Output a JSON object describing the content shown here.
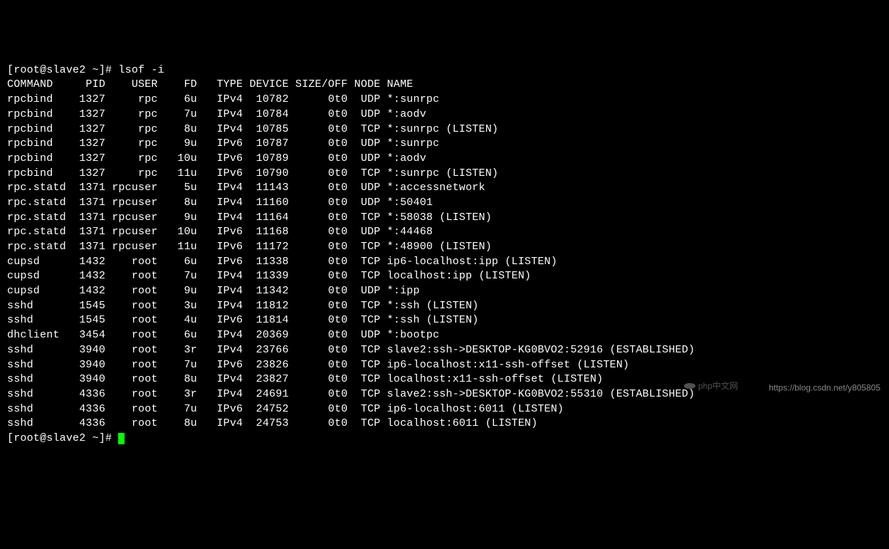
{
  "prompt": "[root@slave2 ~]# lsof -i",
  "prompt2": "[root@slave2 ~]# ",
  "headers": {
    "command": "COMMAND",
    "pid": "PID",
    "user": "USER",
    "fd": "FD",
    "type": "TYPE",
    "device": "DEVICE",
    "sizeoff": "SIZE/OFF",
    "node": "NODE",
    "name": "NAME"
  },
  "rows": [
    {
      "command": "rpcbind",
      "pid": "1327",
      "user": "rpc",
      "fd": "6u",
      "type": "IPv4",
      "device": "10782",
      "sizeoff": "0t0",
      "node": "UDP",
      "name": "*:sunrpc"
    },
    {
      "command": "rpcbind",
      "pid": "1327",
      "user": "rpc",
      "fd": "7u",
      "type": "IPv4",
      "device": "10784",
      "sizeoff": "0t0",
      "node": "UDP",
      "name": "*:aodv"
    },
    {
      "command": "rpcbind",
      "pid": "1327",
      "user": "rpc",
      "fd": "8u",
      "type": "IPv4",
      "device": "10785",
      "sizeoff": "0t0",
      "node": "TCP",
      "name": "*:sunrpc (LISTEN)"
    },
    {
      "command": "rpcbind",
      "pid": "1327",
      "user": "rpc",
      "fd": "9u",
      "type": "IPv6",
      "device": "10787",
      "sizeoff": "0t0",
      "node": "UDP",
      "name": "*:sunrpc"
    },
    {
      "command": "rpcbind",
      "pid": "1327",
      "user": "rpc",
      "fd": "10u",
      "type": "IPv6",
      "device": "10789",
      "sizeoff": "0t0",
      "node": "UDP",
      "name": "*:aodv"
    },
    {
      "command": "rpcbind",
      "pid": "1327",
      "user": "rpc",
      "fd": "11u",
      "type": "IPv6",
      "device": "10790",
      "sizeoff": "0t0",
      "node": "TCP",
      "name": "*:sunrpc (LISTEN)"
    },
    {
      "command": "rpc.statd",
      "pid": "1371",
      "user": "rpcuser",
      "fd": "5u",
      "type": "IPv4",
      "device": "11143",
      "sizeoff": "0t0",
      "node": "UDP",
      "name": "*:accessnetwork"
    },
    {
      "command": "rpc.statd",
      "pid": "1371",
      "user": "rpcuser",
      "fd": "8u",
      "type": "IPv4",
      "device": "11160",
      "sizeoff": "0t0",
      "node": "UDP",
      "name": "*:50401"
    },
    {
      "command": "rpc.statd",
      "pid": "1371",
      "user": "rpcuser",
      "fd": "9u",
      "type": "IPv4",
      "device": "11164",
      "sizeoff": "0t0",
      "node": "TCP",
      "name": "*:58038 (LISTEN)"
    },
    {
      "command": "rpc.statd",
      "pid": "1371",
      "user": "rpcuser",
      "fd": "10u",
      "type": "IPv6",
      "device": "11168",
      "sizeoff": "0t0",
      "node": "UDP",
      "name": "*:44468"
    },
    {
      "command": "rpc.statd",
      "pid": "1371",
      "user": "rpcuser",
      "fd": "11u",
      "type": "IPv6",
      "device": "11172",
      "sizeoff": "0t0",
      "node": "TCP",
      "name": "*:48900 (LISTEN)"
    },
    {
      "command": "cupsd",
      "pid": "1432",
      "user": "root",
      "fd": "6u",
      "type": "IPv6",
      "device": "11338",
      "sizeoff": "0t0",
      "node": "TCP",
      "name": "ip6-localhost:ipp (LISTEN)"
    },
    {
      "command": "cupsd",
      "pid": "1432",
      "user": "root",
      "fd": "7u",
      "type": "IPv4",
      "device": "11339",
      "sizeoff": "0t0",
      "node": "TCP",
      "name": "localhost:ipp (LISTEN)"
    },
    {
      "command": "cupsd",
      "pid": "1432",
      "user": "root",
      "fd": "9u",
      "type": "IPv4",
      "device": "11342",
      "sizeoff": "0t0",
      "node": "UDP",
      "name": "*:ipp"
    },
    {
      "command": "sshd",
      "pid": "1545",
      "user": "root",
      "fd": "3u",
      "type": "IPv4",
      "device": "11812",
      "sizeoff": "0t0",
      "node": "TCP",
      "name": "*:ssh (LISTEN)"
    },
    {
      "command": "sshd",
      "pid": "1545",
      "user": "root",
      "fd": "4u",
      "type": "IPv6",
      "device": "11814",
      "sizeoff": "0t0",
      "node": "TCP",
      "name": "*:ssh (LISTEN)"
    },
    {
      "command": "dhclient",
      "pid": "3454",
      "user": "root",
      "fd": "6u",
      "type": "IPv4",
      "device": "20369",
      "sizeoff": "0t0",
      "node": "UDP",
      "name": "*:bootpc"
    },
    {
      "command": "sshd",
      "pid": "3940",
      "user": "root",
      "fd": "3r",
      "type": "IPv4",
      "device": "23766",
      "sizeoff": "0t0",
      "node": "TCP",
      "name": "slave2:ssh->DESKTOP-KG0BVO2:52916 (ESTABLISHED)"
    },
    {
      "command": "sshd",
      "pid": "3940",
      "user": "root",
      "fd": "7u",
      "type": "IPv6",
      "device": "23826",
      "sizeoff": "0t0",
      "node": "TCP",
      "name": "ip6-localhost:x11-ssh-offset (LISTEN)"
    },
    {
      "command": "sshd",
      "pid": "3940",
      "user": "root",
      "fd": "8u",
      "type": "IPv4",
      "device": "23827",
      "sizeoff": "0t0",
      "node": "TCP",
      "name": "localhost:x11-ssh-offset (LISTEN)"
    },
    {
      "command": "sshd",
      "pid": "4336",
      "user": "root",
      "fd": "3r",
      "type": "IPv4",
      "device": "24691",
      "sizeoff": "0t0",
      "node": "TCP",
      "name": "slave2:ssh->DESKTOP-KG0BVO2:55310 (ESTABLISHED)"
    },
    {
      "command": "sshd",
      "pid": "4336",
      "user": "root",
      "fd": "7u",
      "type": "IPv6",
      "device": "24752",
      "sizeoff": "0t0",
      "node": "TCP",
      "name": "ip6-localhost:6011 (LISTEN)"
    },
    {
      "command": "sshd",
      "pid": "4336",
      "user": "root",
      "fd": "8u",
      "type": "IPv4",
      "device": "24753",
      "sizeoff": "0t0",
      "node": "TCP",
      "name": "localhost:6011 (LISTEN)"
    }
  ],
  "watermark": {
    "php": "php中文网",
    "csdn": "https://blog.csdn.net/y805805"
  }
}
